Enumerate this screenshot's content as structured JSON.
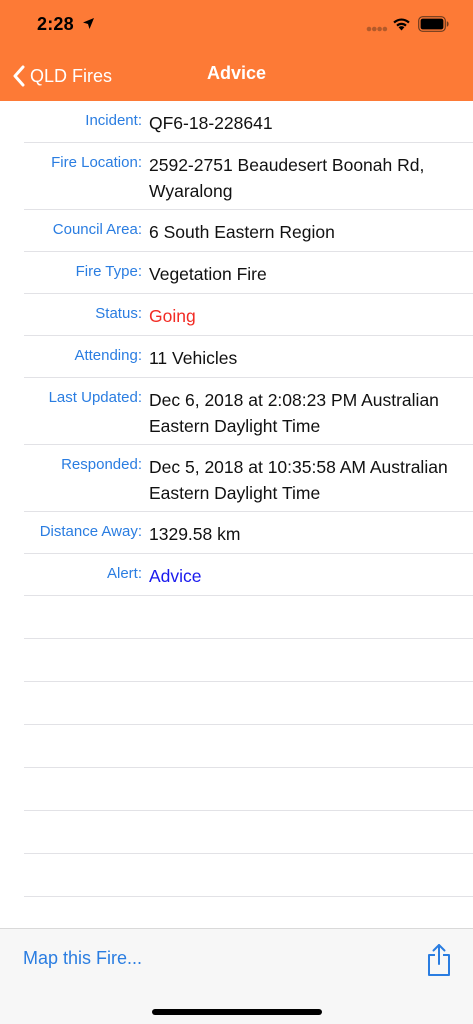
{
  "status_bar": {
    "time": "2:28"
  },
  "nav": {
    "back_label": "QLD Fires",
    "title": "Advice"
  },
  "details": [
    {
      "label": "Incident:",
      "value": "QF6-18-228641",
      "color": "default"
    },
    {
      "label": "Fire Location:",
      "value": "2592-2751 Beaudesert Boonah Rd, Wyaralong",
      "color": "default"
    },
    {
      "label": "Council Area:",
      "value": "6 South Eastern Region",
      "color": "default"
    },
    {
      "label": "Fire Type:",
      "value": "Vegetation Fire",
      "color": "default"
    },
    {
      "label": "Status:",
      "value": "Going",
      "color": "red"
    },
    {
      "label": "Attending:",
      "value": "11 Vehicles",
      "color": "default"
    },
    {
      "label": "Last Updated:",
      "value": "Dec 6, 2018 at 2:08:23 PM Australian Eastern Daylight Time",
      "color": "default"
    },
    {
      "label": "Responded:",
      "value": "Dec 5, 2018 at 10:35:58 AM Australian Eastern Daylight Time",
      "color": "default"
    },
    {
      "label": "Distance Away:",
      "value": "1329.58 km",
      "color": "default"
    },
    {
      "label": "Alert:",
      "value": "Advice",
      "color": "blue"
    }
  ],
  "toolbar": {
    "map_label": "Map this Fire..."
  },
  "colors": {
    "header": "#fd7a36",
    "label": "#2a7de1",
    "status_going": "#f22b24",
    "alert_advice": "#1a1aee"
  },
  "icons": {
    "back": "chevron-left-icon",
    "share": "share-icon",
    "location": "location-arrow-icon",
    "wifi": "wifi-icon",
    "battery": "battery-icon"
  }
}
